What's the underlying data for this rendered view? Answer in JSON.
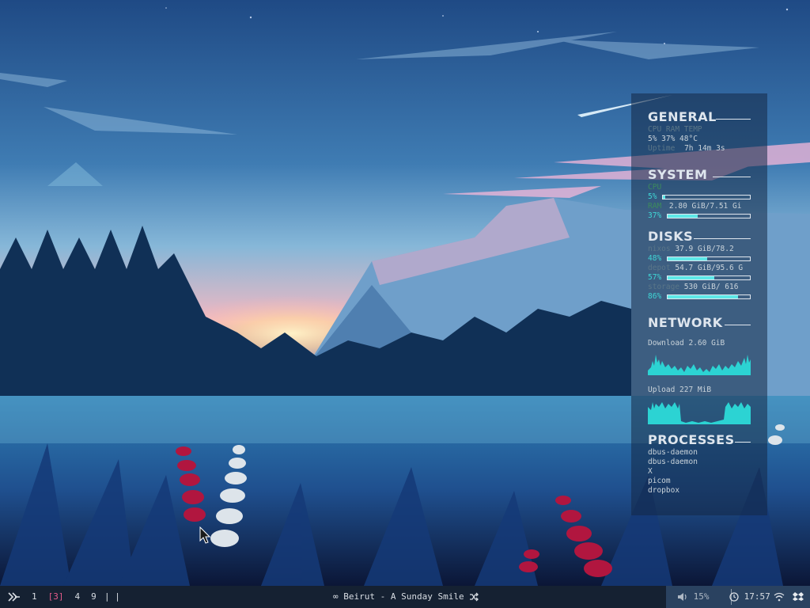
{
  "conky": {
    "general": {
      "title": "GENERAL",
      "labels_line": "CPU  RAM  TEMP",
      "values_line": "5%   37%   48°C",
      "uptime_label": "Uptime",
      "uptime_value": "7h 14m 3s"
    },
    "system": {
      "title": "SYSTEM",
      "cpu_label": "CPU",
      "cpu_percent": "5%",
      "cpu_fill": 0.03,
      "ram_label": "RAM",
      "ram_value": "2.80 GiB/7.51 Gi",
      "ram_percent": "37%",
      "ram_fill": 0.37
    },
    "disks": {
      "title": "DISKS",
      "items": [
        {
          "name": "nixos",
          "value": "37.9 GiB/78.2",
          "percent": "48%",
          "fill": 0.48
        },
        {
          "name": "depot",
          "value": "54.7 GiB/95.6 G",
          "percent": "57%",
          "fill": 0.57
        },
        {
          "name": "storage",
          "value": "530 GiB/ 616",
          "percent": "86%",
          "fill": 0.86
        }
      ]
    },
    "network": {
      "title": "NETWORK",
      "download_label": "Download 2.60 GiB",
      "upload_label": "Upload  227 MiB"
    },
    "processes": {
      "title": "PROCESSES",
      "items": [
        "dbus-daemon",
        "dbus-daemon",
        "X",
        "picom",
        "dropbox"
      ]
    }
  },
  "taskbar": {
    "workspaces": [
      {
        "label": "1",
        "active": false
      },
      {
        "label": "[3]",
        "active": true
      },
      {
        "label": "4",
        "active": false
      },
      {
        "label": "9",
        "active": false
      }
    ],
    "separator": "| |",
    "now_playing": "Beirut - A Sunday Smile",
    "volume": "15%",
    "clock": "17:57",
    "icons": {
      "menu": "logo-icon",
      "loop": "infinity-icon",
      "shuffle": "shuffle-icon",
      "volume": "speaker-icon",
      "clock": "clock-icon",
      "wifi": "wifi-icon",
      "dropbox": "dropbox-icon"
    },
    "colors": {
      "active_workspace": "#e45b8a",
      "bar": "#152132",
      "tray": "#2a4260"
    }
  }
}
